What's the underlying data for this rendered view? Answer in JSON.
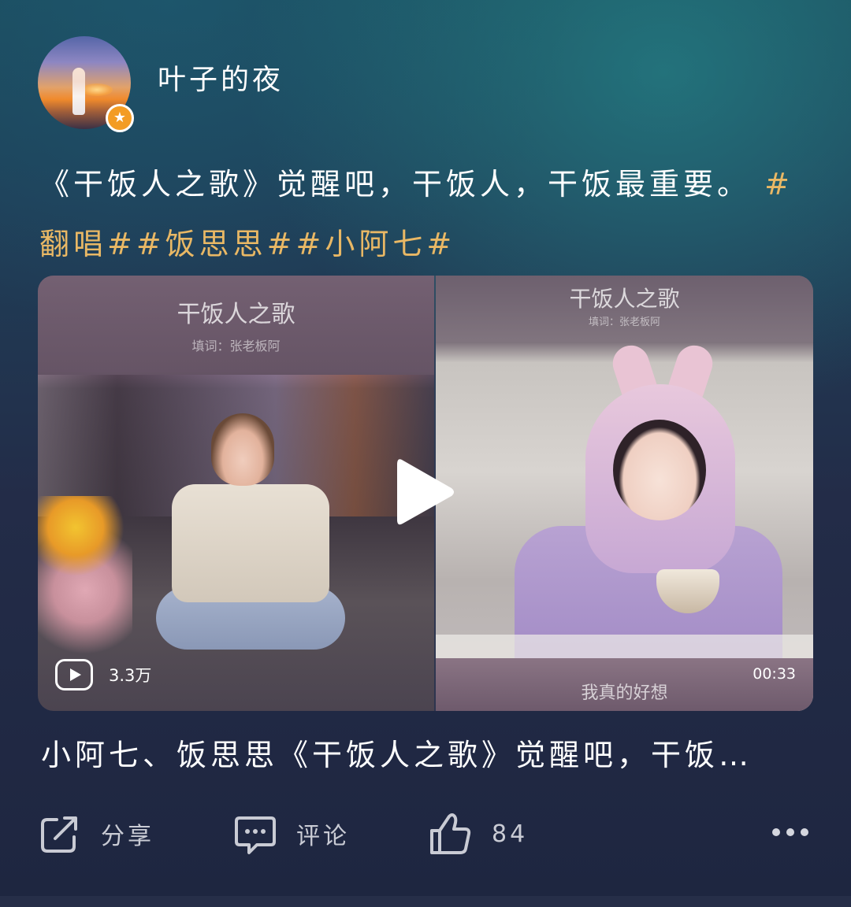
{
  "header": {
    "username": "叶子的夜",
    "badge_icon": "star-icon"
  },
  "post": {
    "text_main": "《干饭人之歌》觉醒吧，干饭人，干饭最重要。",
    "tags": [
      "#翻唱#",
      "#饭思思#",
      "#小阿七#"
    ],
    "tag_color": "#e9b865"
  },
  "video": {
    "left_title": "干饭人之歌",
    "left_lyricist": "填词：张老板阿",
    "right_title": "干饭人之歌",
    "right_lyricist": "填词：张老板阿",
    "subtitle": "我真的好想",
    "view_count": "3.3万",
    "duration": "00:33"
  },
  "description": "小阿七、饭思思《干饭人之歌》觉醒吧，干饭…",
  "actions": {
    "share_label": "分享",
    "comment_label": "评论",
    "like_count": "84"
  }
}
